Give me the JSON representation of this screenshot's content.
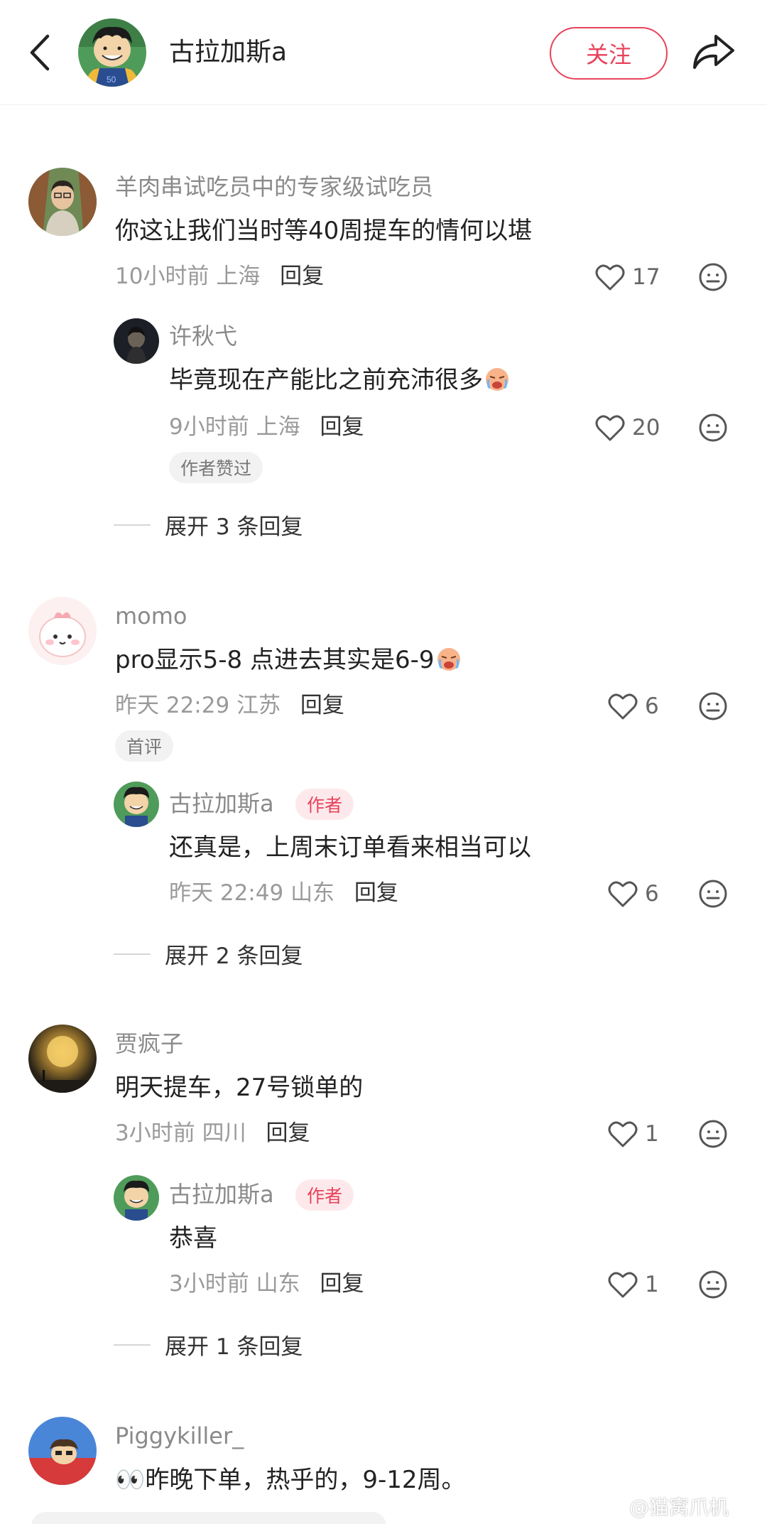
{
  "header": {
    "name": "古拉加斯a",
    "follow_label": "关注",
    "peek_text": "…"
  },
  "comments": [
    {
      "user": "羊肉串试吃员中的专家级试吃员",
      "text": "你这让我们当时等40周提车的情何以堪",
      "time": "10小时前",
      "location": "上海",
      "reply_label": "回复",
      "likes": "17",
      "reply": {
        "user": "许秋弋",
        "text": "毕竟现在产能比之前充沛很多",
        "time": "9小时前",
        "location": "上海",
        "reply_label": "回复",
        "likes": "20",
        "tag": "作者赞过"
      },
      "expand": "展开 3 条回复"
    },
    {
      "user": "momo",
      "text": "pro显示5-8 点进去其实是6-9",
      "time": "昨天 22:29",
      "location": "江苏",
      "reply_label": "回复",
      "likes": "6",
      "tag": "首评",
      "reply": {
        "user": "古拉加斯a",
        "author_tag": "作者",
        "text": "还真是，上周末订单看来相当可以",
        "time": "昨天 22:49",
        "location": "山东",
        "reply_label": "回复",
        "likes": "6"
      },
      "expand": "展开 2 条回复"
    },
    {
      "user": "贾疯子",
      "text": "明天提车，27号锁单的",
      "time": "3小时前",
      "location": "四川",
      "reply_label": "回复",
      "likes": "1",
      "reply": {
        "user": "古拉加斯a",
        "author_tag": "作者",
        "text": "恭喜",
        "time": "3小时前",
        "location": "山东",
        "reply_label": "回复",
        "likes": "1"
      },
      "expand": "展开 1 条回复"
    },
    {
      "user": "Piggykiller_",
      "text": "👀昨晚下单，热乎的，9-12周。"
    }
  ],
  "watermark": "@猫窝爪机",
  "colors": {
    "accent": "#e8425a",
    "meta": "#9a9a9a",
    "text": "#222222"
  }
}
